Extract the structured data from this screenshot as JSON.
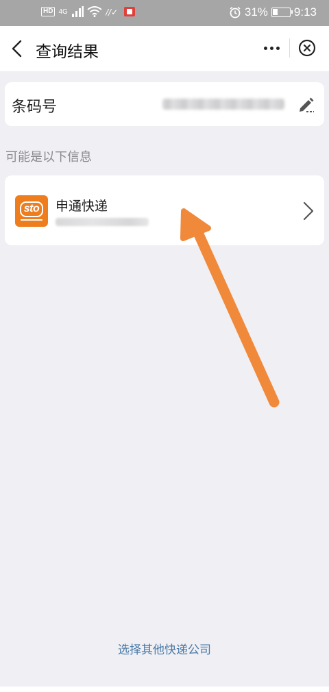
{
  "status_bar": {
    "network": "4G",
    "battery_text": "31%",
    "time": "9:13",
    "battery_level": 0.31
  },
  "nav": {
    "title": "查询结果"
  },
  "barcode": {
    "label": "条码号"
  },
  "hint": "可能是以下信息",
  "results": [
    {
      "company": "申通快递",
      "logo_text": "sto",
      "logo_color": "#ee7d1e"
    }
  ],
  "footer_link": "选择其他快递公司",
  "colors": {
    "accent_link": "#4a7aa6",
    "annotation_arrow": "#f0893a"
  }
}
